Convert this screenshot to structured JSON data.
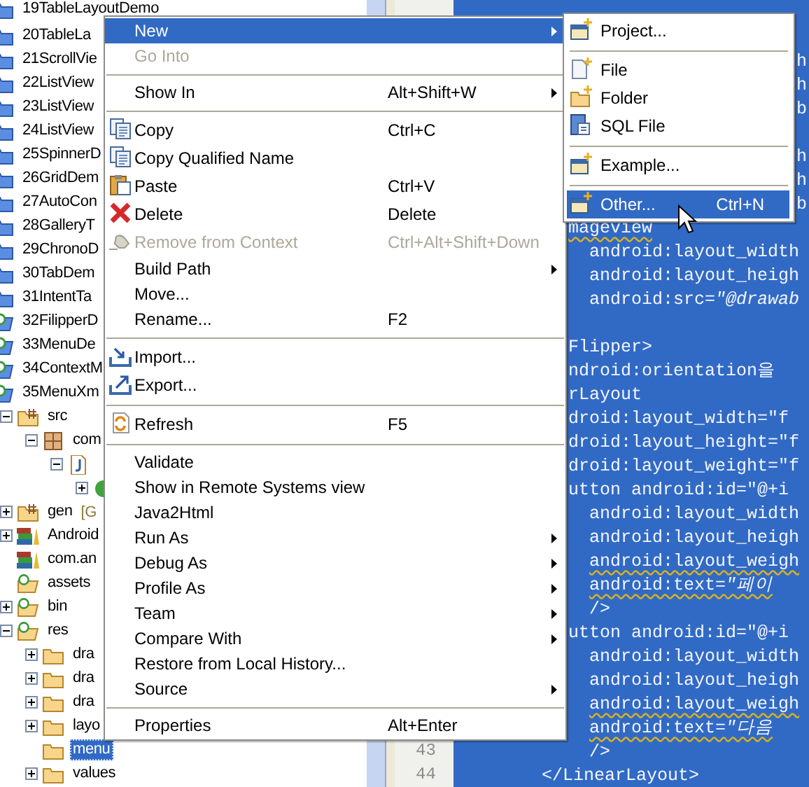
{
  "project_tree": {
    "items": [
      {
        "label": "19TableLayoutDemo",
        "kind": "project",
        "selected": false
      },
      {
        "label": "20TableLa",
        "kind": "project",
        "selected": false
      },
      {
        "label": "21ScrollVie",
        "kind": "project",
        "selected": false
      },
      {
        "label": "22ListView",
        "kind": "project",
        "selected": false
      },
      {
        "label": "23ListView",
        "kind": "project",
        "selected": false
      },
      {
        "label": "24ListView",
        "kind": "project",
        "selected": false
      },
      {
        "label": "25SpinnerD",
        "kind": "project",
        "selected": false
      },
      {
        "label": "26GridDem",
        "kind": "project",
        "selected": false
      },
      {
        "label": "27AutoCon",
        "kind": "project",
        "selected": false
      },
      {
        "label": "28GalleryT",
        "kind": "project",
        "selected": false
      },
      {
        "label": "29ChronoD",
        "kind": "project",
        "selected": false
      },
      {
        "label": "30TabDem",
        "kind": "project",
        "selected": false
      },
      {
        "label": "31IntentTa",
        "kind": "project",
        "selected": false
      },
      {
        "label": "32FilipperD",
        "kind": "android-project",
        "selected": false
      },
      {
        "label": "33MenuDe",
        "kind": "android-project",
        "selected": false
      },
      {
        "label": "34ContextM",
        "kind": "android-project",
        "selected": false
      },
      {
        "label": "35MenuXm",
        "kind": "android-project",
        "selected": false,
        "children": [
          {
            "label": "src",
            "kind": "source-folder",
            "expanded": true,
            "selected": false,
            "children": [
              {
                "label": "com",
                "kind": "package",
                "expanded": true,
                "selected": false,
                "children": [
                  {
                    "kind": "java-file",
                    "expanded": true,
                    "children": [
                      {
                        "kind": "class",
                        "expanded": false
                      }
                    ]
                  }
                ]
              }
            ]
          },
          {
            "label": "gen",
            "decoration": "[G",
            "kind": "source-folder",
            "expanded": false,
            "selected": false
          },
          {
            "label": "Android",
            "kind": "library",
            "expanded": false,
            "selected": false
          },
          {
            "label": "com.an",
            "kind": "library",
            "selected": false
          },
          {
            "label": "assets",
            "kind": "android-folder",
            "selected": false
          },
          {
            "label": "bin",
            "kind": "android-folder",
            "expanded": false,
            "selected": false
          },
          {
            "label": "res",
            "kind": "android-folder",
            "expanded": true,
            "selected": false,
            "children": [
              {
                "label": "dra",
                "kind": "folder",
                "expanded": false,
                "selected": false
              },
              {
                "label": "dra",
                "kind": "folder",
                "expanded": false,
                "selected": false
              },
              {
                "label": "dra",
                "kind": "folder",
                "expanded": false,
                "selected": false
              },
              {
                "label": "layo",
                "kind": "folder",
                "expanded": false,
                "selected": false
              },
              {
                "label": "menu",
                "kind": "folder",
                "selected": true
              },
              {
                "label": "values",
                "kind": "folder",
                "expanded": false,
                "selected": false
              }
            ]
          }
        ]
      }
    ]
  },
  "line_numbers": [
    "43",
    "44"
  ],
  "editor": {
    "lines": [
      {
        "kind": "blank"
      },
      {
        "kind": "blank"
      },
      {
        "kind": "tail",
        "text": "h",
        "warning": false
      },
      {
        "kind": "tail",
        "text": "h",
        "warning": false
      },
      {
        "kind": "tail",
        "text": "b",
        "warning": false
      },
      {
        "kind": "blank"
      },
      {
        "kind": "tail",
        "text": "h",
        "warning": false
      },
      {
        "kind": "tail",
        "text": "h",
        "warning": false
      },
      {
        "kind": "tail",
        "text": "b",
        "warning": false
      },
      {
        "kind": "tag",
        "text": "mageview",
        "warning": true
      },
      {
        "kind": "attr",
        "text": "android:layout_width",
        "warning": false
      },
      {
        "kind": "attr",
        "text": "android:layout_heigh",
        "warning": false
      },
      {
        "kind": "attr",
        "text": "android:src=*\"@drawab*",
        "warning": false
      },
      {
        "kind": "blank"
      },
      {
        "kind": "tag",
        "text": "Flipper>",
        "warning": false
      },
      {
        "kind": "tag",
        "text": "ndroid:orientation을",
        "warning": false
      },
      {
        "kind": "tag",
        "text": "rLayout",
        "warning": false
      },
      {
        "kind": "tag",
        "text": "droid:layout_width=\"f",
        "warning": false
      },
      {
        "kind": "tag",
        "text": "droid:layout_height=\"f",
        "warning": false
      },
      {
        "kind": "tag",
        "text": "droid:layout_weight=\"f",
        "warning": false
      },
      {
        "kind": "tag",
        "text": "utton android:id=\"@+i",
        "warning": false
      },
      {
        "kind": "attr",
        "text": "android:layout_width",
        "warning": false
      },
      {
        "kind": "attr",
        "text": "android:layout_heigh",
        "warning": false
      },
      {
        "kind": "attr",
        "text": "android:layout_weigh",
        "warning": true
      },
      {
        "kind": "attr",
        "text": "android:text=*\"페이*",
        "warning": true
      },
      {
        "kind": "attr",
        "text": "/>",
        "warning": false
      },
      {
        "kind": "tag",
        "text": "utton android:id=\"@+i",
        "warning": false
      },
      {
        "kind": "attr",
        "text": "android:layout_width",
        "warning": false
      },
      {
        "kind": "attr",
        "text": "android:layout_heigh",
        "warning": false
      },
      {
        "kind": "attr",
        "text": "android:layout_weigh",
        "warning": true
      },
      {
        "kind": "attr",
        "text": "android:text=*\"다음*",
        "warning": true
      },
      {
        "kind": "attr",
        "text": "/>",
        "warning": false
      },
      {
        "kind": "end",
        "text": "</LinearLayout>",
        "warning": false
      }
    ]
  },
  "context_menu": {
    "items": [
      {
        "kind": "text",
        "label": "New",
        "submenu": true,
        "disabled": false,
        "selected": true
      },
      {
        "kind": "text",
        "label": "Go Into",
        "submenu": false,
        "disabled": true,
        "selected": false
      },
      {
        "kind": "separator"
      },
      {
        "kind": "text",
        "label": "Show In",
        "shortcut": "Alt+Shift+W",
        "submenu": true,
        "disabled": false,
        "selected": false
      },
      {
        "kind": "separator"
      },
      {
        "kind": "copy",
        "label": "Copy",
        "shortcut": "Ctrl+C",
        "submenu": false,
        "disabled": false,
        "selected": false
      },
      {
        "kind": "copy-name",
        "label": "Copy Qualified Name",
        "submenu": false,
        "disabled": false,
        "selected": false
      },
      {
        "kind": "paste",
        "label": "Paste",
        "shortcut": "Ctrl+V",
        "submenu": false,
        "disabled": false,
        "selected": false
      },
      {
        "kind": "delete",
        "label": "Delete",
        "shortcut": "Delete",
        "submenu": false,
        "disabled": false,
        "selected": false
      },
      {
        "kind": "remove",
        "label": "Remove from Context",
        "shortcut": "Ctrl+Alt+Shift+Down",
        "submenu": false,
        "disabled": true,
        "selected": false
      },
      {
        "kind": "text",
        "label": "Build Path",
        "submenu": true,
        "disabled": false,
        "selected": false
      },
      {
        "kind": "text",
        "label": "Move...",
        "submenu": false,
        "disabled": false,
        "selected": false
      },
      {
        "kind": "text",
        "label": "Rename...",
        "shortcut": "F2",
        "submenu": false,
        "disabled": false,
        "selected": false
      },
      {
        "kind": "separator"
      },
      {
        "kind": "import",
        "label": "Import...",
        "submenu": false,
        "disabled": false,
        "selected": false
      },
      {
        "kind": "export",
        "label": "Export...",
        "submenu": false,
        "disabled": false,
        "selected": false
      },
      {
        "kind": "separator"
      },
      {
        "kind": "refresh",
        "label": "Refresh",
        "shortcut": "F5",
        "submenu": false,
        "disabled": false,
        "selected": false
      },
      {
        "kind": "separator"
      },
      {
        "kind": "text",
        "label": "Validate",
        "submenu": false,
        "disabled": false,
        "selected": false
      },
      {
        "kind": "text",
        "label": "Show in Remote Systems view",
        "submenu": false,
        "disabled": false,
        "selected": false
      },
      {
        "kind": "text",
        "label": "Java2Html",
        "submenu": false,
        "disabled": false,
        "selected": false
      },
      {
        "kind": "text",
        "label": "Run As",
        "submenu": true,
        "disabled": false,
        "selected": false
      },
      {
        "kind": "text",
        "label": "Debug As",
        "submenu": true,
        "disabled": false,
        "selected": false
      },
      {
        "kind": "text",
        "label": "Profile As",
        "submenu": true,
        "disabled": false,
        "selected": false
      },
      {
        "kind": "text",
        "label": "Team",
        "submenu": true,
        "disabled": false,
        "selected": false
      },
      {
        "kind": "text",
        "label": "Compare With",
        "submenu": true,
        "disabled": false,
        "selected": false
      },
      {
        "kind": "text",
        "label": "Restore from Local History...",
        "submenu": false,
        "disabled": false,
        "selected": false
      },
      {
        "kind": "text",
        "label": "Source",
        "submenu": true,
        "disabled": false,
        "selected": false
      },
      {
        "kind": "separator"
      },
      {
        "kind": "text",
        "label": "Properties",
        "shortcut": "Alt+Enter",
        "submenu": false,
        "disabled": false,
        "selected": false
      }
    ]
  },
  "new_submenu": {
    "items": [
      {
        "kind": "project",
        "label": "Project...",
        "selected": false
      },
      {
        "kind": "separator"
      },
      {
        "kind": "file",
        "label": "File",
        "selected": false
      },
      {
        "kind": "folder",
        "label": "Folder",
        "selected": false
      },
      {
        "kind": "sql-file",
        "label": "SQL File",
        "selected": false
      },
      {
        "kind": "separator"
      },
      {
        "kind": "project",
        "label": "Example...",
        "selected": false
      },
      {
        "kind": "separator"
      },
      {
        "kind": "project",
        "label": "Other...",
        "shortcut": "Ctrl+N",
        "selected": true
      }
    ]
  }
}
